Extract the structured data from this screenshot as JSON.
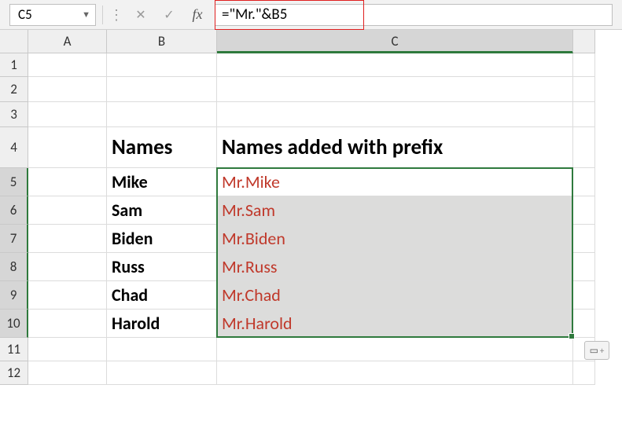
{
  "nameBox": {
    "value": "C5"
  },
  "formulaBar": {
    "value": "=\"Mr.\"&B5"
  },
  "columns": {
    "A": "A",
    "B": "B",
    "C": "C"
  },
  "rowNumbers": [
    "1",
    "2",
    "3",
    "4",
    "5",
    "6",
    "7",
    "8",
    "9",
    "10",
    "11",
    "12"
  ],
  "headers": {
    "B4": "Names",
    "C4": "Names added with prefix"
  },
  "names": {
    "B5": "Mike",
    "B6": "Sam",
    "B7": "Biden",
    "B8": "Russ",
    "B9": "Chad",
    "B10": "Harold"
  },
  "prefixed": {
    "C5": "Mr.Mike",
    "C6": "Mr.Sam",
    "C7": "Mr.Biden",
    "C8": "Mr.Russ",
    "C9": "Mr.Chad",
    "C10": "Mr.Harold"
  },
  "chart_data": {
    "type": "table",
    "title": "Names added with prefix using formula =\"Mr.\"&B5",
    "columns": [
      "Names",
      "Names added with prefix"
    ],
    "rows": [
      [
        "Mike",
        "Mr.Mike"
      ],
      [
        "Sam",
        "Mr.Sam"
      ],
      [
        "Biden",
        "Mr.Biden"
      ],
      [
        "Russ",
        "Mr.Russ"
      ],
      [
        "Chad",
        "Mr.Chad"
      ],
      [
        "Harold",
        "Mr.Harold"
      ]
    ]
  }
}
